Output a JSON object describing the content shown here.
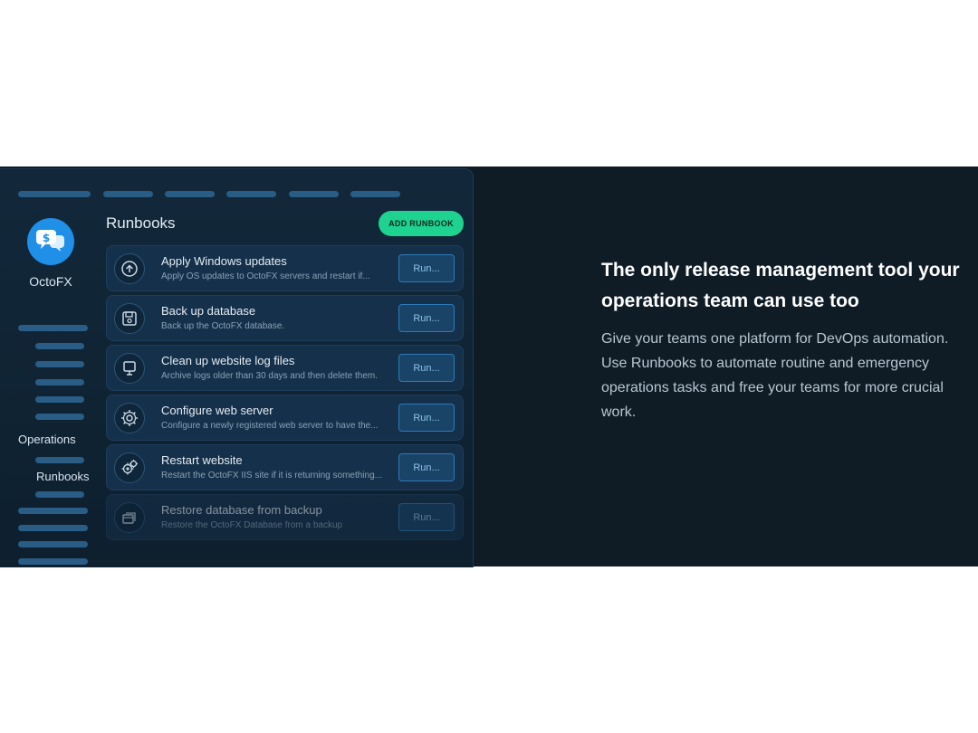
{
  "app": {
    "brand": "OctoFX",
    "page_title": "Runbooks",
    "add_button": "ADD RUNBOOK",
    "sidebar": {
      "section_label": "Operations",
      "active_item": "Runbooks"
    },
    "runbooks": [
      {
        "title": "Apply Windows updates",
        "description": "Apply OS updates to OctoFX servers and restart if...",
        "run_label": "Run...",
        "icon": "upload-circle-icon"
      },
      {
        "title": "Back up database",
        "description": "Back up the OctoFX database.",
        "run_label": "Run...",
        "icon": "save-disk-icon"
      },
      {
        "title": "Clean up website log files",
        "description": "Archive logs older than 30 days and then delete them.",
        "run_label": "Run...",
        "icon": "monitor-icon"
      },
      {
        "title": "Configure web server",
        "description": "Configure a newly registered web server to have the...",
        "run_label": "Run...",
        "icon": "gear-icon"
      },
      {
        "title": "Restart website",
        "description": "Restart the OctoFX IIS site if it is returning something...",
        "run_label": "Run...",
        "icon": "gears-icon"
      },
      {
        "title": "Restore database from backup",
        "description": "Restore the OctoFX Database from a backup",
        "run_label": "Run...",
        "icon": "restore-icon"
      }
    ]
  },
  "marketing": {
    "headline": "The only release management tool your operations team can use too",
    "body": "Give your teams one platform for DevOps automation. Use Runbooks to automate routine and emergency operations tasks and free your teams for more crucial work."
  },
  "colors": {
    "band_background": "#0f1c26",
    "accent_green": "#1ed38f",
    "brand_blue": "#1f8fe8"
  }
}
